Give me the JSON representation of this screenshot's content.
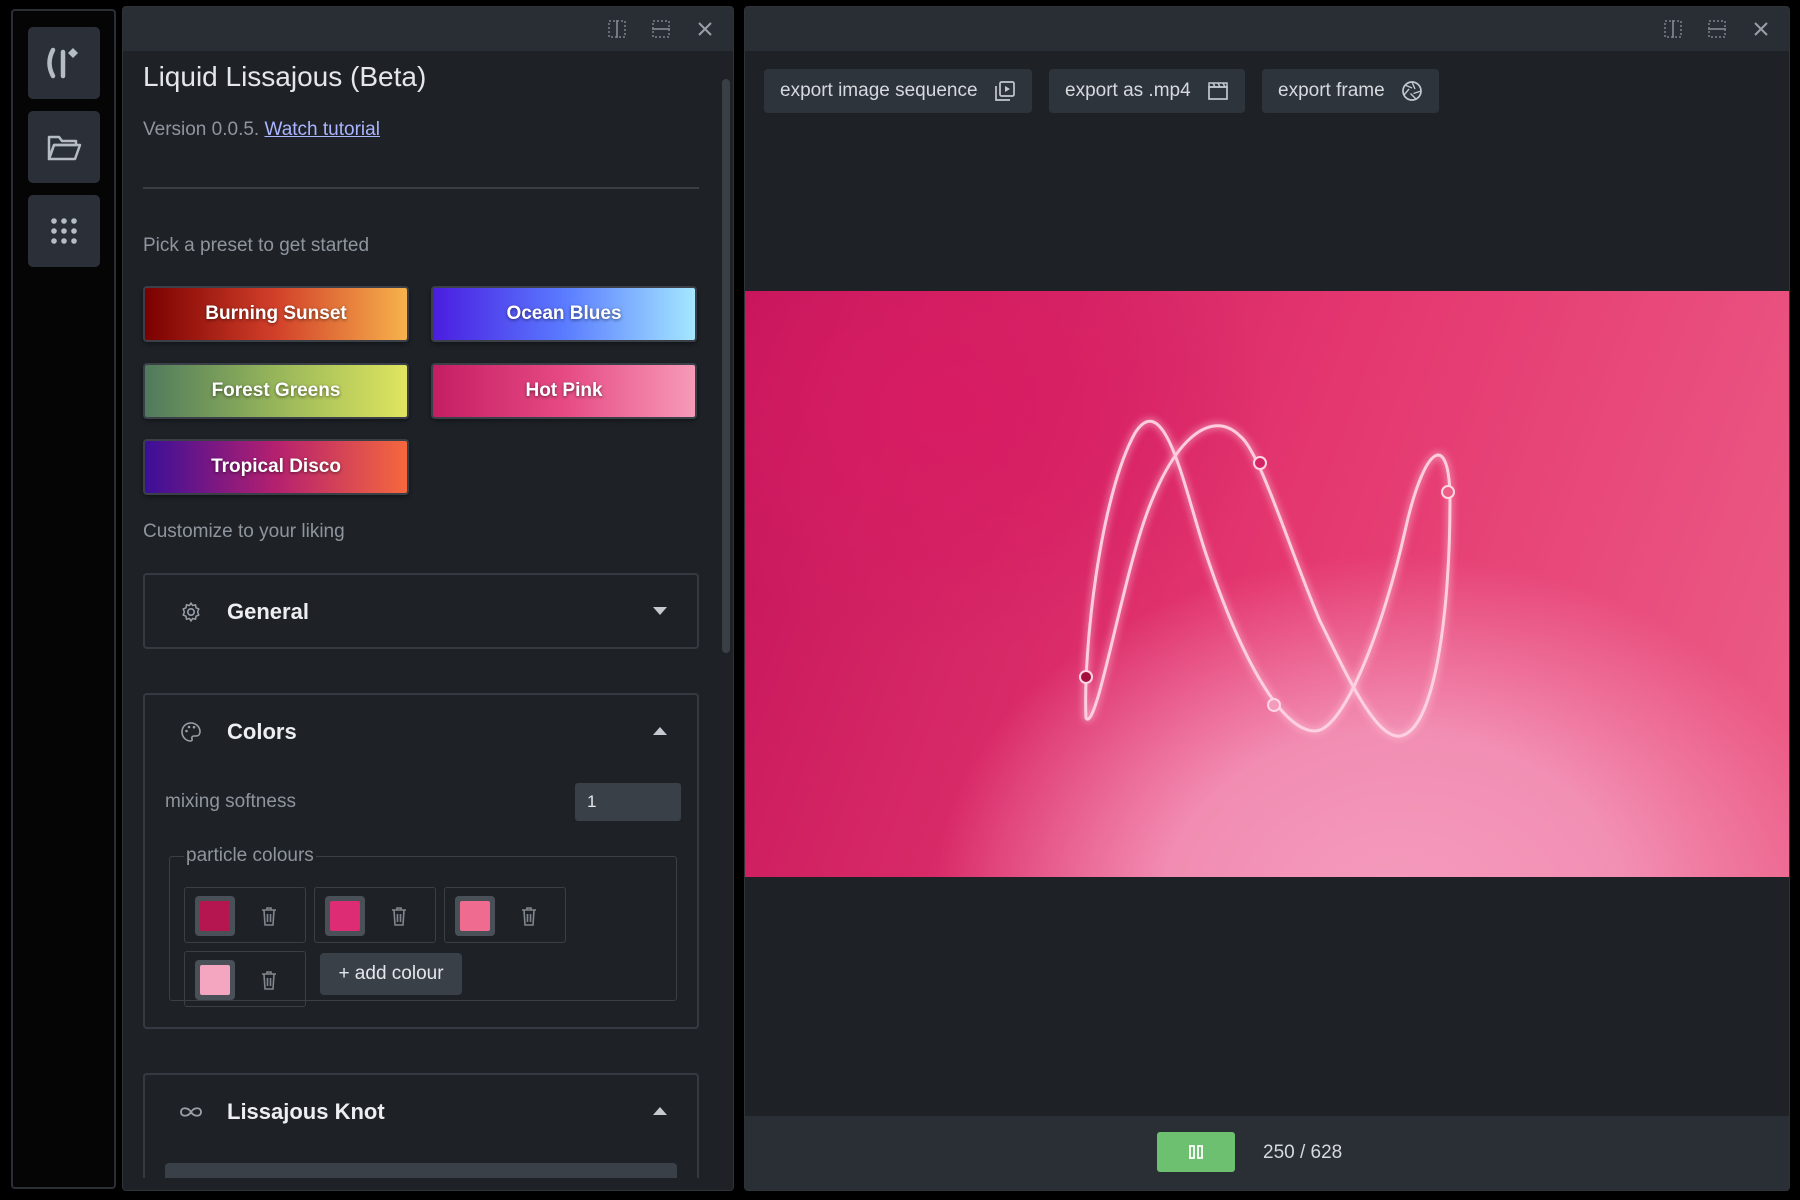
{
  "settings": {
    "title": "Liquid Lissajous (Beta)",
    "version": "Version 0.0.5.",
    "tutorial_link": "Watch tutorial",
    "presets_label": "Pick a preset to get started",
    "presets": [
      {
        "label": "Burning Sunset",
        "colors": [
          "#7a0000",
          "#d2402a",
          "#f7b24b"
        ]
      },
      {
        "label": "Ocean Blues",
        "colors": [
          "#4a1de0",
          "#5a7bff",
          "#a4e7ff"
        ]
      },
      {
        "label": "Forest Greens",
        "colors": [
          "#4f7a5c",
          "#97b65a",
          "#dfe55e"
        ]
      },
      {
        "label": "Hot Pink",
        "colors": [
          "#c41e63",
          "#e64a83",
          "#f79ab8"
        ]
      },
      {
        "label": "Tropical Disco",
        "colors": [
          "#3a0f98",
          "#b5206f",
          "#f5683d"
        ]
      }
    ],
    "customize_label": "Customize to your liking",
    "general": {
      "title": "General",
      "icon": "gear-icon",
      "expanded": false
    },
    "colors": {
      "title": "Colors",
      "icon": "palette-icon",
      "expanded": true,
      "mixing_softness_label": "mixing softness",
      "mixing_softness_value": "1",
      "particle_colours_label": "particle colours",
      "particle_colours": [
        "#b5164f",
        "#dd2c73",
        "#ef6c90",
        "#f4a6c0"
      ],
      "add_colour_label": "+ add colour"
    },
    "lissajous": {
      "title": "Lissajous Knot",
      "icon": "infinity-icon",
      "expanded": true
    }
  },
  "preview": {
    "export_buttons": [
      {
        "label": "export image sequence",
        "icon": "image-sequence-icon"
      },
      {
        "label": "export as .mp4",
        "icon": "clapperboard-icon"
      },
      {
        "label": "export frame",
        "icon": "camera-shutter-icon"
      }
    ],
    "frame_counter": "250 / 628",
    "playback": {
      "icon": "pause-icon",
      "color": "#6cc06f"
    }
  },
  "colors": {
    "accent_link": "#aab4ff",
    "canvas_primary": "#e4366f"
  }
}
